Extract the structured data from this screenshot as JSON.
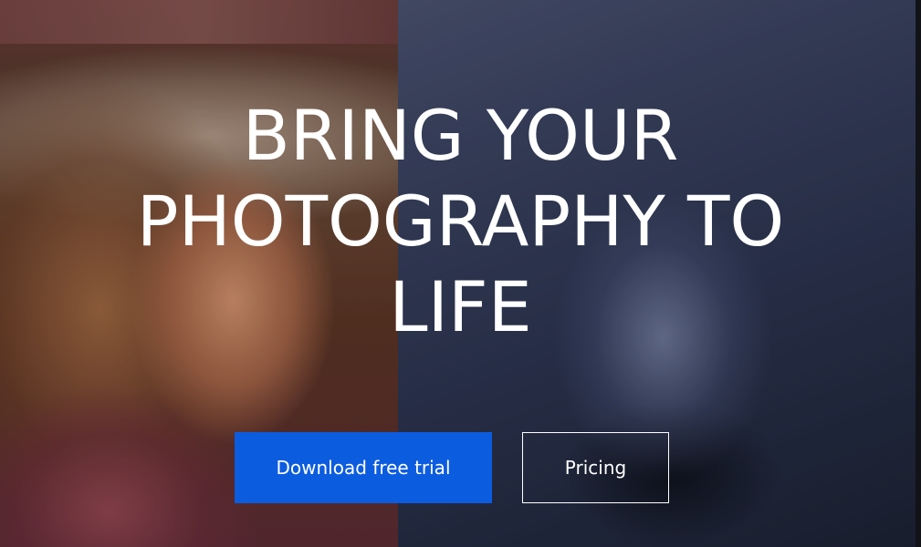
{
  "hero": {
    "headline_lines": [
      "BRING YOUR",
      "PHOTOGRAPHY TO",
      "LIFE"
    ],
    "background_left": "portrait-photo",
    "background_right": "chrome-sculpture-photo"
  },
  "cta": {
    "primary_label": "Download free trial",
    "secondary_label": "Pricing"
  },
  "colors": {
    "primary_button": "#0c5ce0",
    "text": "#ffffff"
  }
}
